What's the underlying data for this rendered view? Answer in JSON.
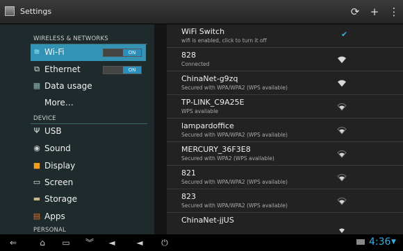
{
  "titlebar": {
    "title": "Settings",
    "btn_refresh_icon": "refresh-icon",
    "btn_add_icon": "plus-icon",
    "btn_menu_icon": "overflow-menu-icon"
  },
  "sidebar": {
    "section_wireless": "WIRELESS & NETWORKS",
    "wifi_label": "Wi-Fi",
    "wifi_toggle": "ON",
    "ethernet_label": "Ethernet",
    "ethernet_toggle": "ON",
    "data_usage_label": "Data usage",
    "more_label": "More…",
    "section_device": "DEVICE",
    "usb_label": "USB",
    "sound_label": "Sound",
    "display_label": "Display",
    "screen_label": "Screen",
    "storage_label": "Storage",
    "apps_label": "Apps",
    "section_personal": "PERSONAL"
  },
  "networks": [
    {
      "name": "WiFi Switch",
      "status": "wifi is enabled, click to turn it off"
    },
    {
      "name": "828",
      "status": "Connected"
    },
    {
      "name": "ChinaNet-g9zq",
      "status": "Secured with WPA/WPA2 (WPS available)"
    },
    {
      "name": "TP-LINK_C9A25E",
      "status": "WPS available"
    },
    {
      "name": "lampardoffice",
      "status": "Secured with WPA/WPA2 (WPS available)"
    },
    {
      "name": "MERCURY_36F3E8",
      "status": "Secured with WPA2 (WPS available)"
    },
    {
      "name": "821",
      "status": "Secured with WPA/WPA2 (WPS available)"
    },
    {
      "name": "823",
      "status": "Secured with WPA/WPA2 (WPS available)"
    },
    {
      "name": "ChinaNet-jjUS",
      "status": ""
    }
  ],
  "navbar": {
    "clock": "4:36"
  },
  "colors": {
    "accent": "#3493b4",
    "clock": "#37aee0"
  }
}
